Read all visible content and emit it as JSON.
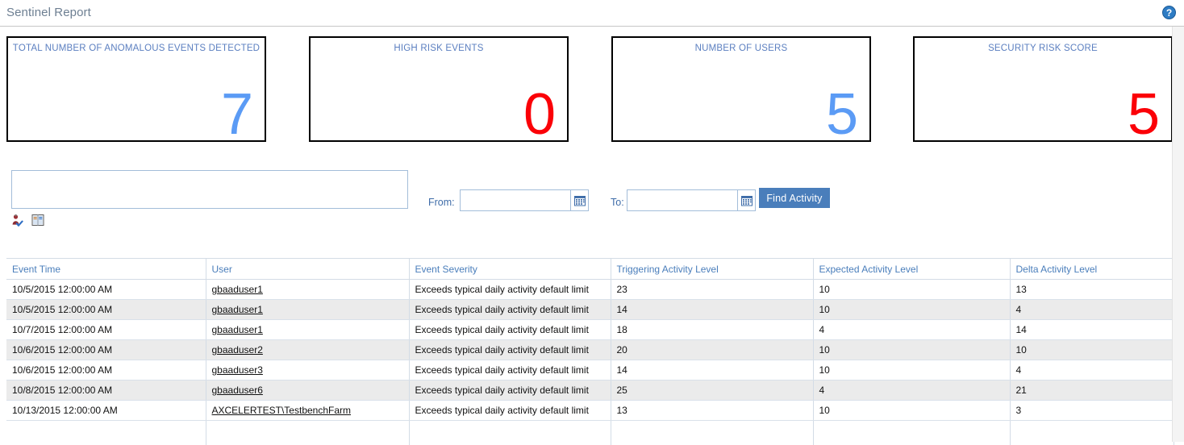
{
  "header": {
    "title": "Sentinel Report",
    "help_icon": "help-circle-icon",
    "help_label": "?"
  },
  "kpi_cards": [
    {
      "title": "TOTAL NUMBER OF ANOMALOUS EVENTS DETECTED",
      "value": "7",
      "color": "#5b9bf5",
      "tone": "blue"
    },
    {
      "title": "HIGH RISK EVENTS",
      "value": "0",
      "color": "#fb0007",
      "tone": "red"
    },
    {
      "title": "NUMBER OF USERS",
      "value": "5",
      "color": "#5b9bf5",
      "tone": "blue"
    },
    {
      "title": "SECURITY RISK SCORE",
      "value": "5",
      "color": "#fb0007",
      "tone": "red"
    }
  ],
  "filters": {
    "people_picker": {
      "value": "",
      "placeholder": ""
    },
    "check_names_icon": "person-check-icon",
    "browse_icon": "address-book-icon",
    "from_label": "From:",
    "from_value": "",
    "to_label": "To:",
    "to_value": "",
    "calendar_icon": "calendar-icon",
    "find_button": "Find Activity",
    "accent_color": "#4a7ebb"
  },
  "table": {
    "columns": [
      "Event Time",
      "User",
      "Event Severity",
      "Triggering Activity Level",
      "Expected Activity Level",
      "Delta Activity Level"
    ],
    "rows": [
      {
        "event_time": "10/5/2015 12:00:00 AM",
        "user": "gbaaduser1",
        "severity": "Exceeds typical daily activity default limit",
        "triggering": "23",
        "expected": "10",
        "delta": "13"
      },
      {
        "event_time": "10/5/2015 12:00:00 AM",
        "user": "gbaaduser1",
        "severity": "Exceeds typical daily activity default limit",
        "triggering": "14",
        "expected": "10",
        "delta": "4"
      },
      {
        "event_time": "10/7/2015 12:00:00 AM",
        "user": "gbaaduser1",
        "severity": "Exceeds typical daily activity default limit",
        "triggering": "18",
        "expected": "4",
        "delta": "14"
      },
      {
        "event_time": "10/6/2015 12:00:00 AM",
        "user": "gbaaduser2",
        "severity": "Exceeds typical daily activity default limit",
        "triggering": "20",
        "expected": "10",
        "delta": "10"
      },
      {
        "event_time": "10/6/2015 12:00:00 AM",
        "user": "gbaaduser3",
        "severity": "Exceeds typical daily activity default limit",
        "triggering": "14",
        "expected": "10",
        "delta": "4"
      },
      {
        "event_time": "10/8/2015 12:00:00 AM",
        "user": "gbaaduser6",
        "severity": "Exceeds typical daily activity default limit",
        "triggering": "25",
        "expected": "4",
        "delta": "21"
      },
      {
        "event_time": "10/13/2015 12:00:00 AM",
        "user": "AXCELERTEST\\TestbenchFarm",
        "severity": "Exceeds typical daily activity default limit",
        "triggering": "13",
        "expected": "10",
        "delta": "3"
      }
    ]
  }
}
